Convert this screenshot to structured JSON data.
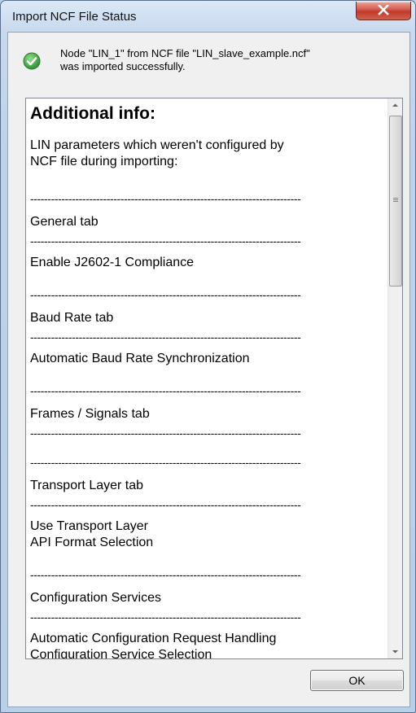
{
  "window": {
    "title": "Import NCF File Status"
  },
  "status": {
    "icon": "checkmark-success-icon",
    "line1": "Node \"LIN_1\" from NCF file \"LIN_slave_example.ncf\"",
    "line2": "was imported successfully."
  },
  "info": {
    "heading": "Additional info:",
    "intro_line1": "LIN parameters which weren't configured by",
    "intro_line2": "NCF file during importing:",
    "separator": "------------------------------------------------------------------------------",
    "general_tab": "General tab",
    "general_item1": "Enable J2602-1 Compliance",
    "baud_tab": "Baud Rate tab",
    "baud_item1": "Automatic Baud Rate Synchronization",
    "frames_tab": "Frames / Signals tab",
    "transport_tab": "Transport Layer tab",
    "transport_item1": "Use Transport Layer",
    "transport_item2": "API Format Selection",
    "config_services": "Configuration Services",
    "config_item1": "Automatic Configuration Request Handling",
    "config_item2": "Configuration Service Selection"
  },
  "buttons": {
    "ok_label": "OK"
  },
  "colors": {
    "success_green": "#3aa63a",
    "close_red": "#c8453a"
  }
}
